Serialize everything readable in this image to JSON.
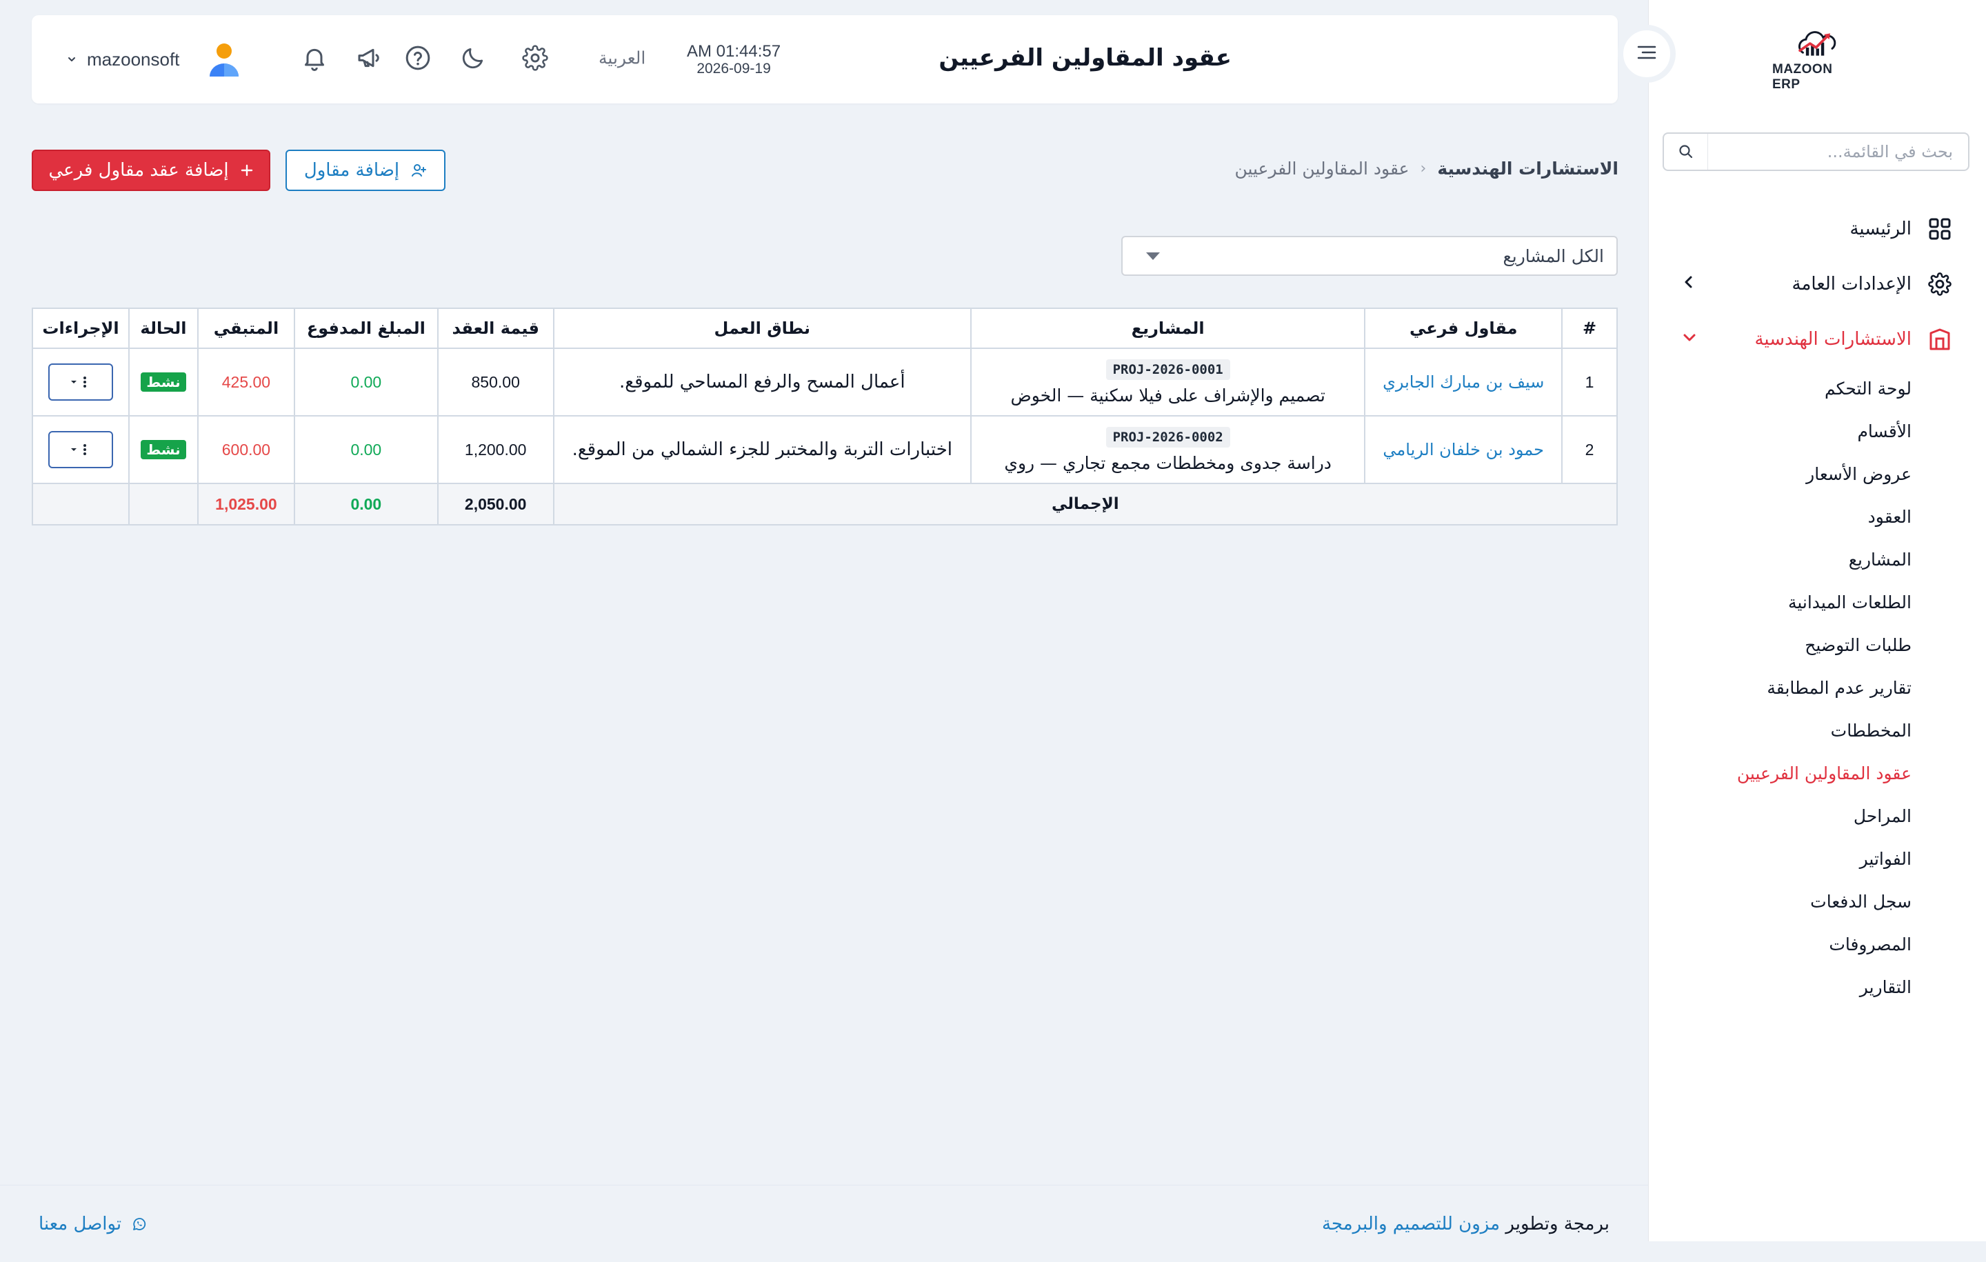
{
  "header": {
    "page_title": "عقود المقاولين الفرعيين",
    "user_name": "mazoonsoft",
    "language": "العربية",
    "time": "AM 01:44:57",
    "date": "2026-09-19"
  },
  "sidebar": {
    "logo_text": "MAZOON ERP",
    "search_placeholder": "بحث في القائمة...",
    "items": [
      {
        "label": "الرئيسية",
        "icon": "grid-icon"
      },
      {
        "label": "الإعدادات العامة",
        "icon": "gear-icon"
      },
      {
        "label": "الاستشارات الهندسية",
        "icon": "building-icon"
      }
    ],
    "submenu": [
      "لوحة التحكم",
      "الأقسام",
      "عروض الأسعار",
      "العقود",
      "المشاريع",
      "الطلعات الميدانية",
      "طلبات التوضيح",
      "تقارير عدم المطابقة",
      "المخططات",
      "عقود المقاولين الفرعيين",
      "المراحل",
      "الفواتير",
      "سجل الدفعات",
      "المصروفات",
      "التقارير"
    ]
  },
  "breadcrumb": {
    "parent": "الاستشارات الهندسية",
    "current": "عقود المقاولين الفرعيين"
  },
  "buttons": {
    "add_contract": "إضافة عقد مقاول فرعي",
    "add_contractor": "إضافة مقاول"
  },
  "filter": {
    "selected": "الكل المشاريع"
  },
  "table": {
    "headers": [
      "#",
      "مقاول فرعي",
      "المشاريع",
      "نطاق العمل",
      "قيمة العقد",
      "المبلغ المدفوع",
      "المتبقي",
      "الحالة",
      "الإجراءات"
    ],
    "rows": [
      {
        "num": "1",
        "contractor": "سيف بن مبارك الجابري",
        "project_code": "PROJ-2026-0001",
        "project_name": "تصميم والإشراف على فيلا سكنية — الخوض",
        "scope": "أعمال المسح والرفع المساحي للموقع.",
        "contract_value": "850.00",
        "paid": "0.00",
        "remaining": "425.00",
        "status": "نشط"
      },
      {
        "num": "2",
        "contractor": "حمود بن خلفان الريامي",
        "project_code": "PROJ-2026-0002",
        "project_name": "دراسة جدوى ومخططات مجمع تجاري — روي",
        "scope": "اختبارات التربة والمختبر للجزء الشمالي من الموقع.",
        "contract_value": "1,200.00",
        "paid": "0.00",
        "remaining": "600.00",
        "status": "نشط"
      }
    ],
    "total_label": "الإجمالي",
    "total_contract": "2,050.00",
    "total_paid": "0.00",
    "total_remaining": "1,025.00"
  },
  "footer": {
    "prefix": "برمجة وتطوير",
    "company": "مزون للتصميم والبرمجة",
    "contact": "تواصل معنا"
  },
  "colors": {
    "accent_red": "#e0313f",
    "link_blue": "#1d7ec2",
    "status_green": "#16a34a",
    "paid_green": "#10a957",
    "remaining_red": "#e54848"
  }
}
